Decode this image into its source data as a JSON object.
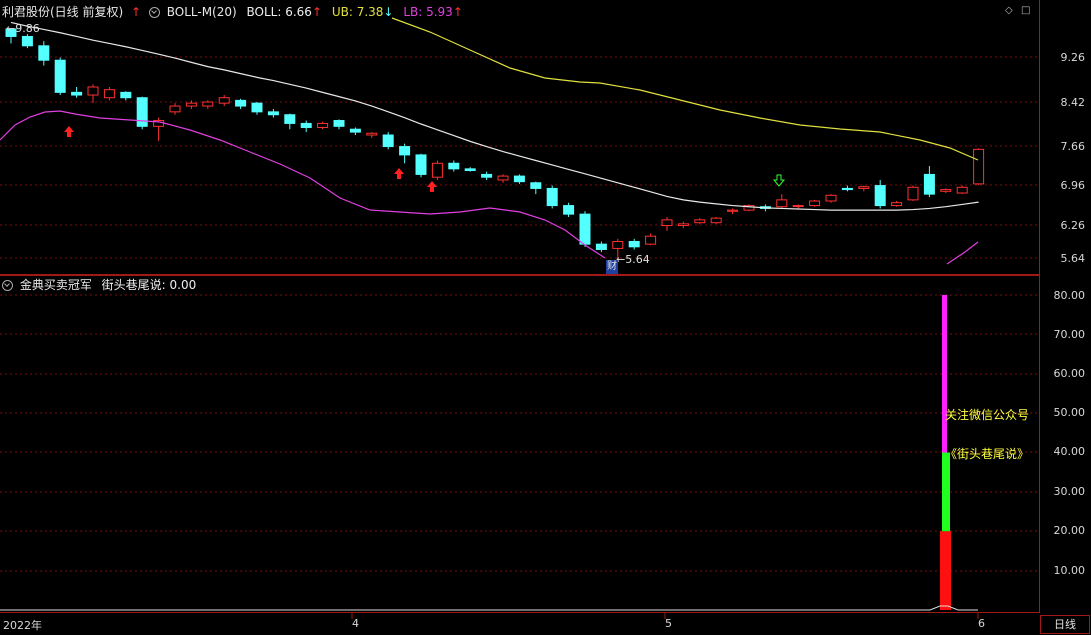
{
  "header": {
    "stock_name": "利君股份(日线 前复权)",
    "indicator": "BOLL-M(20)",
    "boll_text": "BOLL: 6.66",
    "ub_text": "UB: 7.38",
    "lb_text": "LB: 5.93",
    "up_arrow": "↑",
    "down_arrow": "↓"
  },
  "sub_header": {
    "indicator_name": "金典买卖冠军",
    "value_text": "街头巷尾说: 0.00"
  },
  "price_axis": [
    "9.26",
    "8.42",
    "7.66",
    "6.96",
    "6.26",
    "5.64"
  ],
  "volume_axis": [
    "80.00",
    "70.00",
    "60.00",
    "50.00",
    "40.00",
    "30.00",
    "20.00",
    "10.00"
  ],
  "date_axis": [
    "2022年",
    "4",
    "5",
    "6"
  ],
  "annotations": {
    "high_value": "9.86",
    "low_value": "5.64",
    "fin_badge": "财"
  },
  "overlay": {
    "line1": "关注微信公众号",
    "line2": "《街头巷尾说》"
  },
  "period_button": "日线",
  "colors": {
    "up": "#ff3030",
    "down": "#54ffff",
    "boll_mid": "#e8e8e8",
    "boll_ub": "#e0e040",
    "boll_lb": "#e040e0",
    "grid": "#7a0e0e",
    "frame": "#a01818"
  },
  "chart_data": {
    "type": "candlestick",
    "ohlc_approx": [
      [
        9.86,
        9.86,
        9.55,
        9.7
      ],
      [
        9.7,
        9.75,
        9.45,
        9.5
      ],
      [
        9.5,
        9.6,
        9.1,
        9.2
      ],
      [
        9.2,
        9.25,
        8.55,
        8.6
      ],
      [
        8.6,
        8.7,
        8.5,
        8.55
      ],
      [
        8.55,
        8.75,
        8.4,
        8.7
      ],
      [
        8.5,
        8.7,
        8.45,
        8.65
      ],
      [
        8.6,
        8.62,
        8.45,
        8.5
      ],
      [
        8.5,
        8.52,
        7.95,
        8.0
      ],
      [
        8.0,
        8.15,
        7.75,
        8.1
      ],
      [
        8.25,
        8.4,
        8.2,
        8.35
      ],
      [
        8.35,
        8.45,
        8.3,
        8.4
      ],
      [
        8.35,
        8.45,
        8.3,
        8.42
      ],
      [
        8.4,
        8.55,
        8.35,
        8.5
      ],
      [
        8.45,
        8.48,
        8.3,
        8.35
      ],
      [
        8.4,
        8.42,
        8.2,
        8.25
      ],
      [
        8.25,
        8.3,
        8.15,
        8.2
      ],
      [
        8.2,
        8.22,
        7.95,
        8.05
      ],
      [
        8.05,
        8.1,
        7.9,
        7.98
      ],
      [
        7.98,
        8.08,
        7.95,
        8.05
      ],
      [
        8.1,
        8.12,
        7.95,
        8.0
      ],
      [
        7.95,
        7.98,
        7.85,
        7.9
      ],
      [
        7.85,
        7.9,
        7.8,
        7.88
      ],
      [
        7.85,
        7.9,
        7.6,
        7.65
      ],
      [
        7.65,
        7.7,
        7.35,
        7.5
      ],
      [
        7.5,
        7.52,
        7.1,
        7.15
      ],
      [
        7.1,
        7.4,
        7.05,
        7.35
      ],
      [
        7.35,
        7.4,
        7.2,
        7.25
      ],
      [
        7.25,
        7.28,
        7.2,
        7.22
      ],
      [
        7.15,
        7.2,
        7.05,
        7.1
      ],
      [
        7.05,
        7.15,
        7.0,
        7.12
      ],
      [
        7.12,
        7.15,
        6.98,
        7.02
      ],
      [
        7.0,
        7.02,
        6.8,
        6.9
      ],
      [
        6.9,
        6.95,
        6.55,
        6.6
      ],
      [
        6.6,
        6.65,
        6.4,
        6.45
      ],
      [
        6.45,
        6.5,
        5.85,
        5.9
      ],
      [
        5.9,
        5.95,
        5.75,
        5.8
      ],
      [
        5.82,
        6.0,
        5.64,
        5.95
      ],
      [
        5.95,
        6.0,
        5.8,
        5.85
      ],
      [
        5.9,
        6.1,
        5.88,
        6.05
      ],
      [
        6.25,
        6.4,
        6.15,
        6.35
      ],
      [
        6.25,
        6.32,
        6.2,
        6.28
      ],
      [
        6.3,
        6.38,
        6.28,
        6.35
      ],
      [
        6.3,
        6.4,
        6.28,
        6.38
      ],
      [
        6.5,
        6.55,
        6.45,
        6.52
      ],
      [
        6.52,
        6.62,
        6.5,
        6.6
      ],
      [
        6.58,
        6.62,
        6.5,
        6.55
      ],
      [
        6.58,
        6.8,
        6.55,
        6.7
      ],
      [
        6.6,
        6.62,
        6.55,
        6.6
      ],
      [
        6.6,
        6.7,
        6.58,
        6.68
      ],
      [
        6.68,
        6.8,
        6.65,
        6.78
      ],
      [
        6.9,
        6.95,
        6.85,
        6.88
      ],
      [
        6.9,
        6.95,
        6.85,
        6.93
      ],
      [
        6.95,
        7.05,
        6.55,
        6.6
      ],
      [
        6.6,
        6.68,
        6.58,
        6.65
      ],
      [
        6.7,
        6.95,
        6.68,
        6.92
      ],
      [
        7.15,
        7.3,
        6.75,
        6.8
      ],
      [
        6.85,
        6.9,
        6.82,
        6.88
      ],
      [
        6.82,
        6.95,
        6.8,
        6.92
      ],
      [
        6.98,
        7.62,
        6.96,
        7.6
      ]
    ],
    "boll_mid_approx": [
      10.0,
      9.92,
      9.85,
      9.78,
      9.7,
      9.62,
      9.55,
      9.48,
      9.4,
      9.32,
      9.24,
      9.16,
      9.08,
      9.02,
      8.95,
      8.88,
      8.82,
      8.75,
      8.68,
      8.6,
      8.52,
      8.44,
      8.35,
      8.25,
      8.15,
      8.04,
      7.94,
      7.84,
      7.74,
      7.65,
      7.56,
      7.48,
      7.4,
      7.32,
      7.24,
      7.16,
      7.08,
      7.0,
      6.92,
      6.84,
      6.76,
      6.7,
      6.66,
      6.63,
      6.6,
      6.58,
      6.56,
      6.55,
      6.54,
      6.53,
      6.52,
      6.52,
      6.52,
      6.52,
      6.52,
      6.53,
      6.55,
      6.58,
      6.62,
      6.66
    ],
    "ub_points": "from (392,18) sloping down to (978,160)",
    "lb_approx": [
      7.65,
      7.95,
      8.1,
      8.08,
      8.02,
      7.96,
      7.9,
      7.8,
      7.7,
      7.6,
      7.45,
      7.3,
      7.15,
      7.05,
      6.95,
      6.85,
      6.78,
      6.72,
      6.66,
      6.62,
      6.55,
      6.48,
      6.35,
      6.2,
      5.95
    ],
    "signal_bar": {
      "label": "街头巷尾说",
      "red": 20,
      "green": 40,
      "magenta": 80
    }
  }
}
